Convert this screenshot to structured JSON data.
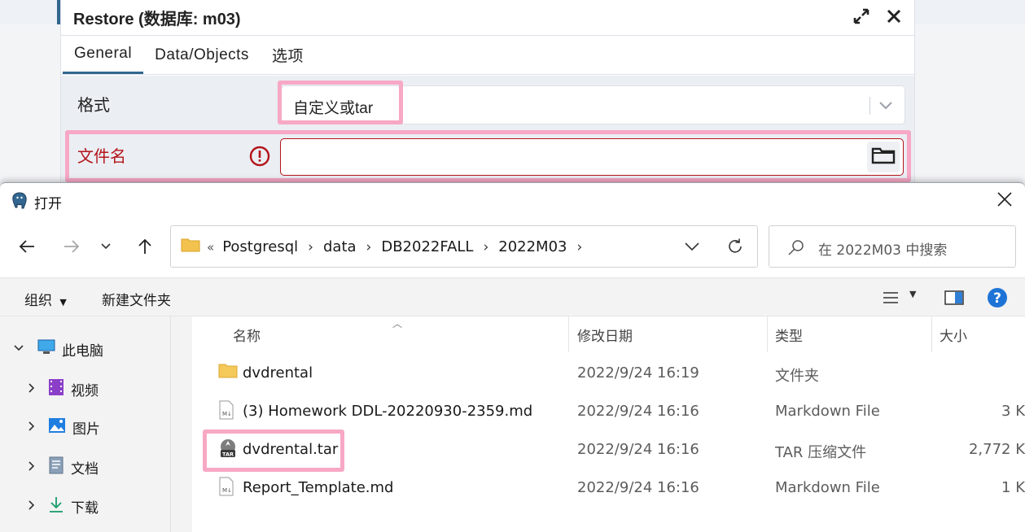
{
  "restore_dialog": {
    "title": "Restore (数据库: m03)",
    "tabs": [
      {
        "label": "General"
      },
      {
        "label": "Data/Objects"
      },
      {
        "label": "选项"
      }
    ],
    "format_label": "格式",
    "format_value": "自定义或tar",
    "filename_label": "文件名",
    "filename_value": "",
    "error_color": "#b3151a",
    "accent_color": "#326690",
    "highlight_color": "#f7a8c4"
  },
  "open_dialog": {
    "title": "打开",
    "breadcrumb": {
      "prefix": "«",
      "parts": [
        "Postgresql",
        "data",
        "DB2022FALL",
        "2022M03"
      ]
    },
    "search_placeholder": "在 2022M03 中搜索",
    "commands": {
      "organize": "组织",
      "new_folder": "新建文件夹"
    },
    "nav_tree": [
      {
        "label": "此电脑",
        "icon": "computer-icon",
        "expanded": true
      },
      {
        "label": "视频",
        "icon": "video-icon"
      },
      {
        "label": "图片",
        "icon": "pictures-icon"
      },
      {
        "label": "文档",
        "icon": "documents-icon"
      },
      {
        "label": "下载",
        "icon": "downloads-icon"
      }
    ],
    "columns": [
      "名称",
      "修改日期",
      "类型",
      "大小"
    ],
    "files": [
      {
        "name": "dvdrental",
        "date": "2022/9/24 16:19",
        "type": "文件夹",
        "size": "",
        "icon": "folder-icon"
      },
      {
        "name": "(3) Homework  DDL-20220930-2359.md",
        "date": "2022/9/24 16:16",
        "type": "Markdown File",
        "size": "3 K",
        "icon": "markdown-file-icon"
      },
      {
        "name": "dvdrental.tar",
        "date": "2022/9/24 16:16",
        "type": "TAR 压缩文件",
        "size": "2,772 K",
        "icon": "tar-file-icon"
      },
      {
        "name": "Report_Template.md",
        "date": "2022/9/24 16:16",
        "type": "Markdown File",
        "size": "1 K",
        "icon": "markdown-file-icon"
      }
    ]
  }
}
